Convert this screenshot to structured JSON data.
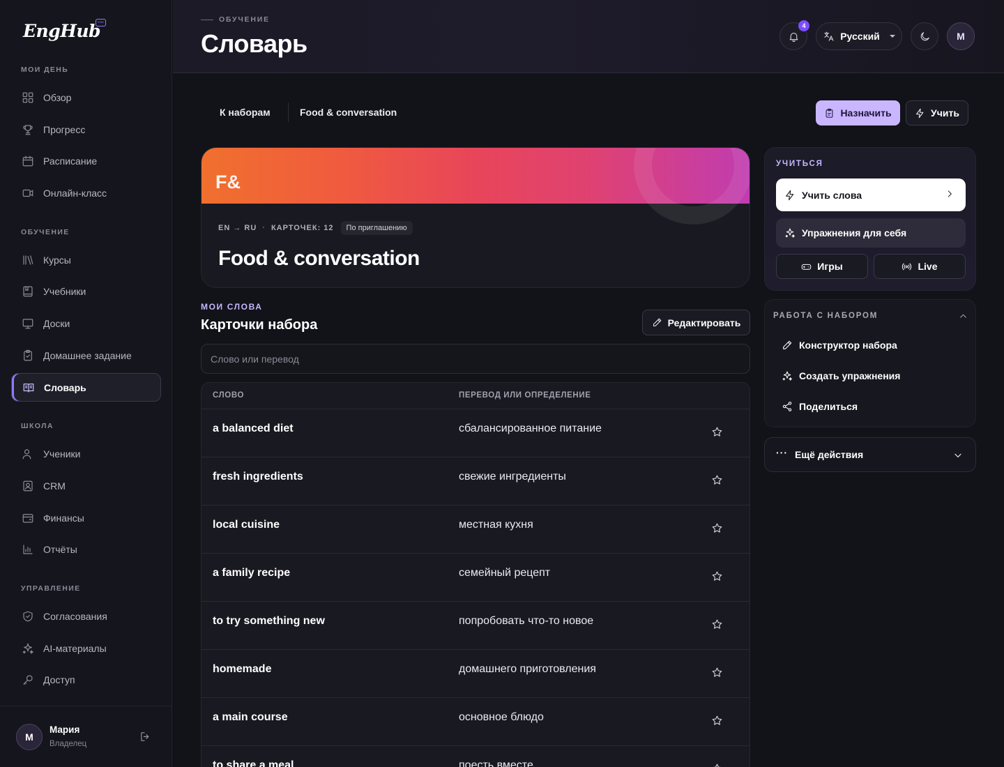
{
  "app": {
    "logo": "EngHub",
    "logo_badge": "ENG"
  },
  "sidebar": {
    "sections": [
      {
        "label": "МОИ ДЕНЬ",
        "items": [
          {
            "label": "Обзор",
            "icon": "grid-icon"
          },
          {
            "label": "Прогресс",
            "icon": "trophy-icon"
          },
          {
            "label": "Расписание",
            "icon": "calendar-icon"
          },
          {
            "label": "Онлайн-класс",
            "icon": "video-icon"
          }
        ]
      },
      {
        "label": "ОБУЧЕНИЕ",
        "items": [
          {
            "label": "Курсы",
            "icon": "library-icon"
          },
          {
            "label": "Учебники",
            "icon": "book-icon"
          },
          {
            "label": "Доски",
            "icon": "board-icon"
          },
          {
            "label": "Домашнее задание",
            "icon": "clipboard-icon"
          },
          {
            "label": "Словарь",
            "icon": "dictionary-icon",
            "active": true
          }
        ]
      },
      {
        "label": "ШКОЛА",
        "items": [
          {
            "label": "Ученики",
            "icon": "users-icon"
          },
          {
            "label": "CRM",
            "icon": "contact-icon"
          },
          {
            "label": "Финансы",
            "icon": "wallet-icon"
          },
          {
            "label": "Отчёты",
            "icon": "bar-chart-icon"
          }
        ]
      },
      {
        "label": "УПРАВЛЕНИЕ",
        "items": [
          {
            "label": "Согласования",
            "icon": "shield-check-icon"
          },
          {
            "label": "AI-материалы",
            "icon": "sparkles-icon"
          },
          {
            "label": "Доступ",
            "icon": "key-icon"
          }
        ]
      }
    ],
    "user": {
      "initial": "M",
      "name": "Мария",
      "role": "Владелец"
    }
  },
  "header": {
    "eyebrow": "ОБУЧЕНИЕ",
    "title": "Словарь",
    "notifications_count": "4",
    "language": "Русский",
    "avatar_initial": "M"
  },
  "toolbar": {
    "back_label": "К наборам",
    "set_name": "Food & conversation",
    "assign_label": "Назначить",
    "learn_label": "Учить"
  },
  "set_card": {
    "abbr": "F&",
    "lang_pair": "EN → RU",
    "separator": "·",
    "cards_count": "КАРТОЧЕК: 12",
    "access_badge": "По приглашению",
    "title": "Food & conversation"
  },
  "words": {
    "eyebrow": "МОИ СЛОВА",
    "title": "Карточки набора",
    "edit_label": "Редактировать",
    "search_placeholder": "Слово или перевод",
    "columns": {
      "word": "СЛОВО",
      "translation": "ПЕРЕВОД ИЛИ ОПРЕДЕЛЕНИЕ"
    },
    "rows": [
      {
        "word": "a balanced diet",
        "translation": "сбалансированное питание"
      },
      {
        "word": "fresh ingredients",
        "translation": "свежие ингредиенты"
      },
      {
        "word": "local cuisine",
        "translation": "местная кухня"
      },
      {
        "word": "a family recipe",
        "translation": "семейный рецепт"
      },
      {
        "word": "to try something new",
        "translation": "попробовать что-то новое"
      },
      {
        "word": "homemade",
        "translation": "домашнего приготовления"
      },
      {
        "word": "a main course",
        "translation": "основное блюдо"
      },
      {
        "word": "to share a meal",
        "translation": "поесть вместе"
      }
    ]
  },
  "learn_panel": {
    "label": "УЧИТЬСЯ",
    "learn_words": "Учить слова",
    "exercises": "Упражнения для себя",
    "games": "Игры",
    "live": "Live"
  },
  "work_panel": {
    "label": "РАБОТА С НАБОРОМ",
    "items": [
      {
        "label": "Конструктор набора",
        "icon": "pencil-icon"
      },
      {
        "label": "Создать упражнения",
        "icon": "sparkles-icon"
      },
      {
        "label": "Поделиться",
        "icon": "share-icon"
      }
    ]
  },
  "more_actions": {
    "label": "Ещё действия"
  },
  "colors": {
    "accent": "#c9b6ff",
    "accent_text": "#c5b6ff",
    "background": "#121219",
    "badge": "#7c4dff"
  }
}
